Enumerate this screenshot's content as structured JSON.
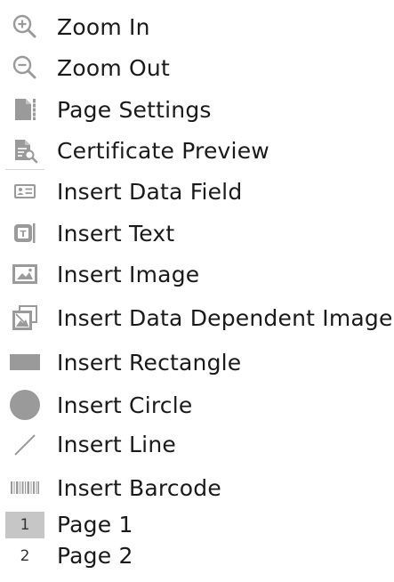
{
  "colors": {
    "icon": "#9a9a9a",
    "text": "#1a1a1a",
    "active_page_bg": "#c6c6c6"
  },
  "menu": {
    "items": [
      {
        "label": "Zoom In",
        "icon": "zoom-in-icon"
      },
      {
        "label": "Zoom Out",
        "icon": "zoom-out-icon"
      },
      {
        "label": "Page Settings",
        "icon": "page-settings-icon"
      },
      {
        "label": "Certificate Preview",
        "icon": "certificate-preview-icon"
      },
      {
        "label": "Insert Data Field",
        "icon": "data-field-icon"
      },
      {
        "label": "Insert Text",
        "icon": "text-icon"
      },
      {
        "label": "Insert Image",
        "icon": "image-icon"
      },
      {
        "label": "Insert Data Dependent Image",
        "icon": "data-dependent-image-icon"
      },
      {
        "label": "Insert Rectangle",
        "icon": "rectangle-icon"
      },
      {
        "label": "Insert Circle",
        "icon": "circle-icon"
      },
      {
        "label": "Insert Line",
        "icon": "line-icon"
      },
      {
        "label": "Insert Barcode",
        "icon": "barcode-icon"
      }
    ]
  },
  "pages": [
    {
      "number": "1",
      "label": "Page 1",
      "active": true
    },
    {
      "number": "2",
      "label": "Page 2",
      "active": false
    }
  ]
}
